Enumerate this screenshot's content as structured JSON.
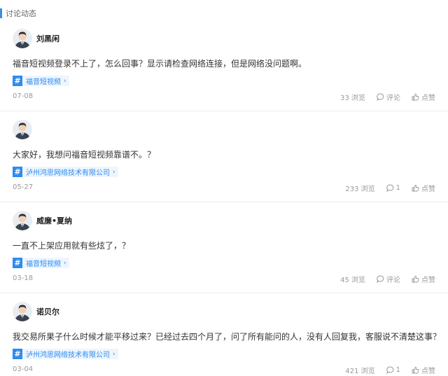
{
  "section": {
    "title": "讨论动态"
  },
  "posts": [
    {
      "username": "刘黑闲",
      "content": "福音短视频登录不上了，怎么回事？显示请检查网络连接，但是网络没问题啊。",
      "tag": "福音短视频",
      "date": "07-08",
      "views": "33 浏览",
      "comments": "评论",
      "likes": "点赞"
    },
    {
      "username": "",
      "content": "大家好，我想问福音短视频靠谱不。？",
      "tag": "泸州鸿思网络技术有限公司",
      "date": "05-27",
      "views": "233 浏览",
      "comments": "1",
      "likes": "点赞"
    },
    {
      "username": "威廉•夏纳",
      "content": "一直不上架应用就有些炫了，？",
      "tag": "福音短视频",
      "date": "03-18",
      "views": "45 浏览",
      "comments": "评论",
      "likes": "点赞"
    },
    {
      "username": "诺贝尔",
      "content": "我交易所果子什么时候才能平移过来？已经过去四个月了，问了所有能问的人，没有人回复我，客服说不清楚这事？",
      "tag": "泸州鸿思网络技术有限公司",
      "date": "03-04",
      "views": "421 浏览",
      "comments": "1",
      "likes": "点赞"
    }
  ],
  "colors": {
    "accent": "#2d8cf0",
    "muted": "#999999"
  },
  "icons": {
    "avatar": "avatar-icon",
    "comment": "comment-icon",
    "like": "thumbs-up-icon",
    "tag": "hash-icon",
    "chevron": "chevron-right-icon"
  }
}
